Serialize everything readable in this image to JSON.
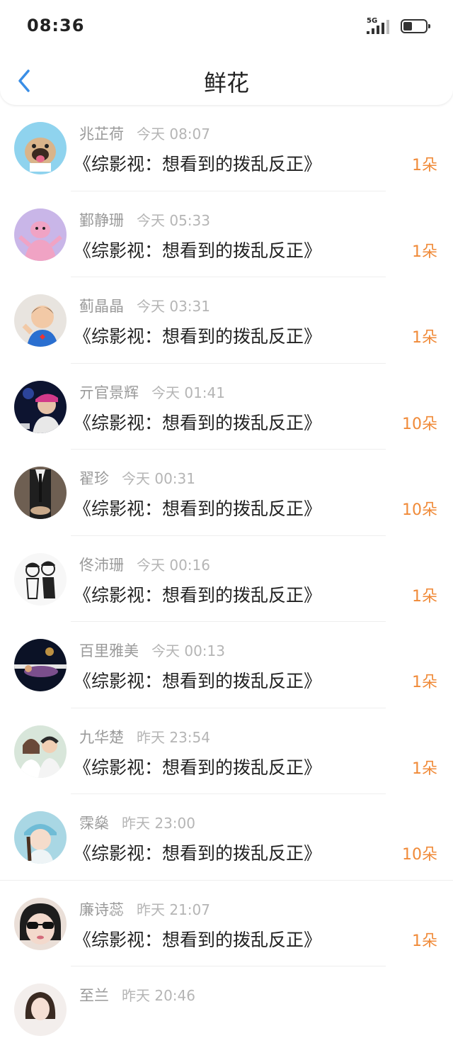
{
  "status_bar": {
    "time": "08:36",
    "network": "5G"
  },
  "header": {
    "title": "鲜花"
  },
  "items": [
    {
      "name": "兆芷荷",
      "time": "今天 08:07",
      "work": "《综影视：想看到的拨乱反正》",
      "count": "1朵",
      "avatar": "dog-avatar"
    },
    {
      "name": "鄞静珊",
      "time": "今天 05:33",
      "work": "《综影视：想看到的拨乱反正》",
      "count": "1朵",
      "avatar": "pink-panther-avatar"
    },
    {
      "name": "蓟晶晶",
      "time": "今天 03:31",
      "work": "《综影视：想看到的拨乱反正》",
      "count": "1朵",
      "avatar": "child-avatar"
    },
    {
      "name": "亓官景辉",
      "time": "今天 01:41",
      "work": "《综影视：想看到的拨乱反正》",
      "count": "10朵",
      "avatar": "concert-avatar"
    },
    {
      "name": "翟珍",
      "time": "今天 00:31",
      "work": "《综影视：想看到的拨乱反正》",
      "count": "10朵",
      "avatar": "suit-avatar"
    },
    {
      "name": "佟沛珊",
      "time": "今天 00:16",
      "work": "《综影视：想看到的拨乱反正》",
      "count": "1朵",
      "avatar": "manga-avatar"
    },
    {
      "name": "百里雅美",
      "time": "今天 00:13",
      "work": "《综影视：想看到的拨乱反正》",
      "count": "1朵",
      "avatar": "night-avatar"
    },
    {
      "name": "九华楚",
      "time": "昨天 23:54",
      "work": "《综影视：想看到的拨乱反正》",
      "count": "1朵",
      "avatar": "couple-avatar"
    },
    {
      "name": "霂燊",
      "time": "昨天 23:00",
      "work": "《综影视：想看到的拨乱反正》",
      "count": "10朵",
      "avatar": "girl-cap-avatar"
    },
    {
      "name": "廉诗蕊",
      "time": "昨天 21:07",
      "work": "《综影视：想看到的拨乱反正》",
      "count": "1朵",
      "avatar": "sunglasses-avatar"
    },
    {
      "name": "至兰",
      "time": "昨天 20:46",
      "work": "",
      "count": "",
      "avatar": "woman-avatar"
    }
  ],
  "colors": {
    "accent": "#3a8ee6",
    "count": "#f08a38",
    "name": "#9a9a9a",
    "time": "#b5b5b5"
  }
}
